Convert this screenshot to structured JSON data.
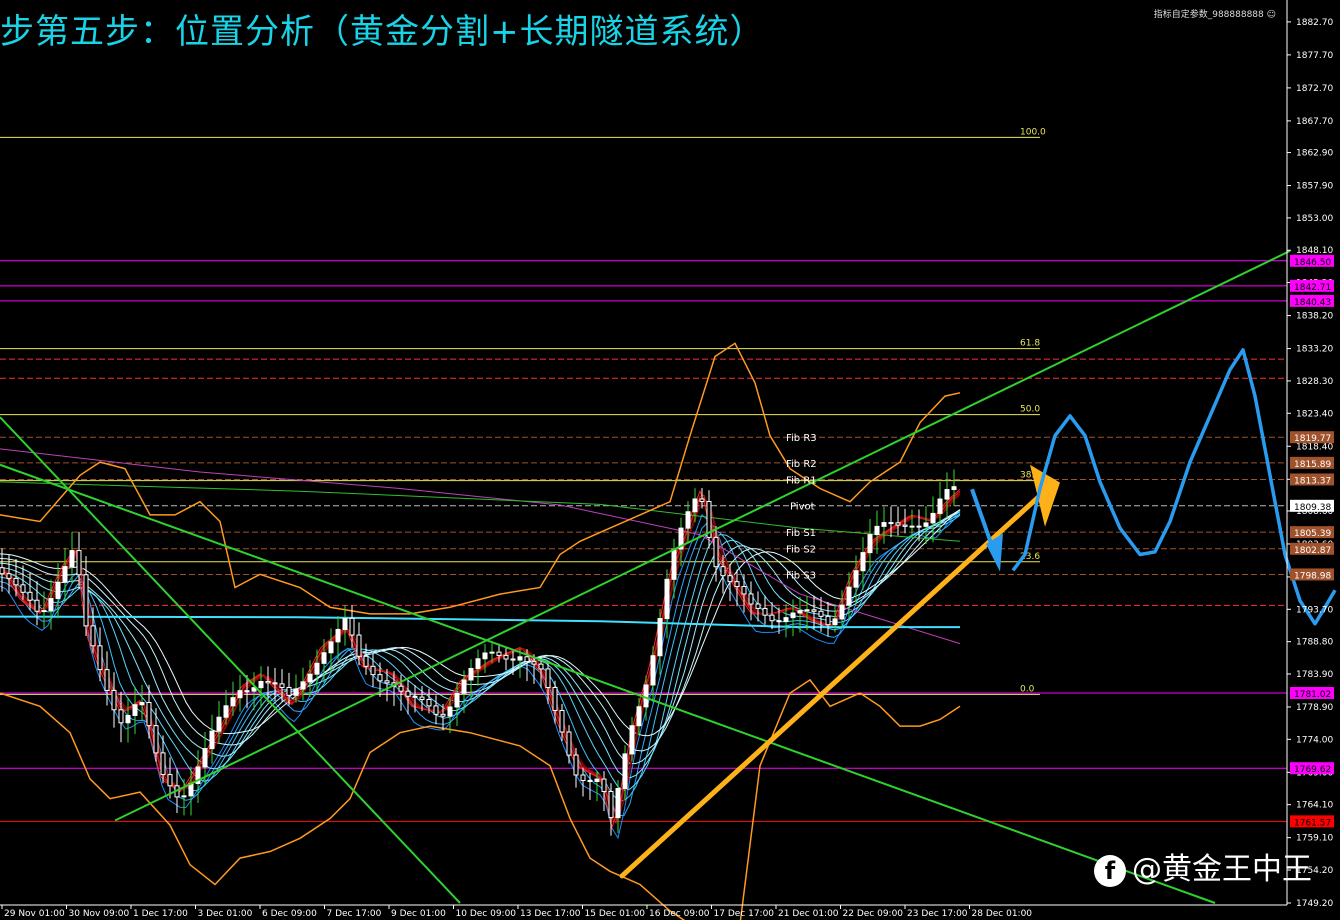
{
  "title": "步第五步：位置分析（黄金分割+长期隧道系统）",
  "ea_label": "指标自定参数_988888888 ☺",
  "watermark": "@黄金王中王",
  "watermark_badge": "f",
  "chart_data": {
    "type": "line",
    "yaxis": {
      "min": 1749.2,
      "max": 1884.5,
      "side": "right"
    },
    "y_ticks": [
      "1882.70",
      "1877.70",
      "1872.70",
      "1867.70",
      "1862.90",
      "1857.90",
      "1853.00",
      "1848.10",
      "1843.20",
      "1838.20",
      "1833.20",
      "1828.30",
      "1823.40",
      "1818.40",
      "1813.40",
      "1808.60",
      "1803.60",
      "1798.60",
      "1793.70",
      "1788.80",
      "1783.90",
      "1778.90",
      "1774.00",
      "1769.00",
      "1764.10",
      "1759.10",
      "1754.20",
      "1749.20"
    ],
    "x_ticks": [
      {
        "label": "29 Nov 01:00",
        "x": 0
      },
      {
        "label": "30 Nov 09:00",
        "x": 1
      },
      {
        "label": "1 Dec 17:00",
        "x": 2
      },
      {
        "label": "3 Dec 01:00",
        "x": 3
      },
      {
        "label": "6 Dec 09:00",
        "x": 4
      },
      {
        "label": "7 Dec 17:00",
        "x": 5
      },
      {
        "label": "9 Dec 01:00",
        "x": 6
      },
      {
        "label": "10 Dec 09:00",
        "x": 7
      },
      {
        "label": "13 Dec 17:00",
        "x": 8
      },
      {
        "label": "15 Dec 01:00",
        "x": 9
      },
      {
        "label": "16 Dec 09:00",
        "x": 10
      },
      {
        "label": "17 Dec 17:00",
        "x": 11
      },
      {
        "label": "21 Dec 01:00",
        "x": 12
      },
      {
        "label": "22 Dec 09:00",
        "x": 13
      },
      {
        "label": "23 Dec 17:00",
        "x": 14
      },
      {
        "label": "28 Dec 01:00",
        "x": 15
      }
    ],
    "fib_levels": [
      {
        "label": "100.0",
        "price": 1865.2
      },
      {
        "label": "61.8",
        "price": 1833.2
      },
      {
        "label": "50.0",
        "price": 1823.2
      },
      {
        "label": "38.2",
        "price": 1813.2
      },
      {
        "label": "23.6",
        "price": 1800.9
      },
      {
        "label": "0.0",
        "price": 1780.8
      }
    ],
    "pivot_labels": [
      {
        "label": "Fib R3",
        "price": 1819.8
      },
      {
        "label": "Fib R2",
        "price": 1815.9
      },
      {
        "label": "Fib R1",
        "price": 1813.4
      },
      {
        "label": "Pivot",
        "price": 1809.4
      },
      {
        "label": "Fib S1",
        "price": 1805.4
      },
      {
        "label": "Fib S2",
        "price": 1802.9
      },
      {
        "label": "Fib S3",
        "price": 1799.0
      }
    ],
    "price_tags": [
      {
        "value": "1846.50",
        "price": 1846.5,
        "color": "#ff00ff",
        "text": "#000000"
      },
      {
        "value": "1842.71",
        "price": 1842.71,
        "color": "#ff00ff",
        "text": "#000000"
      },
      {
        "value": "1840.43",
        "price": 1840.43,
        "color": "#ff00ff",
        "text": "#000000"
      },
      {
        "value": "1819.77",
        "price": 1819.77,
        "color": "#a0522d",
        "text": "#ffffff"
      },
      {
        "value": "1815.89",
        "price": 1815.89,
        "color": "#a0522d",
        "text": "#ffffff"
      },
      {
        "value": "1813.37",
        "price": 1813.37,
        "color": "#a0522d",
        "text": "#ffffff"
      },
      {
        "value": "1809.38",
        "price": 1809.38,
        "color": "#ffffff",
        "text": "#000000"
      },
      {
        "value": "1805.39",
        "price": 1805.39,
        "color": "#a0522d",
        "text": "#ffffff"
      },
      {
        "value": "1802.87",
        "price": 1802.87,
        "color": "#a0522d",
        "text": "#ffffff"
      },
      {
        "value": "1798.98",
        "price": 1798.98,
        "color": "#a0522d",
        "text": "#ffffff"
      },
      {
        "value": "1781.02",
        "price": 1781.02,
        "color": "#ff00ff",
        "text": "#000000"
      },
      {
        "value": "1769.62",
        "price": 1769.62,
        "color": "#ff00ff",
        "text": "#000000"
      },
      {
        "value": "1761.57",
        "price": 1761.57,
        "color": "#ff0000",
        "text": "#000000"
      }
    ],
    "magenta_levels": [
      1846.5,
      1842.71,
      1840.43,
      1781.02,
      1769.62
    ],
    "red_level": 1761.57,
    "dash_levels": [
      {
        "price": 1831.6,
        "color": "#ff3030"
      },
      {
        "price": 1828.7,
        "color": "#ff3030"
      },
      {
        "price": 1819.77,
        "color": "#a0522d"
      },
      {
        "price": 1815.89,
        "color": "#a0522d"
      },
      {
        "price": 1813.37,
        "color": "#a0522d"
      },
      {
        "price": 1809.38,
        "color": "#bbbbbb"
      },
      {
        "price": 1805.39,
        "color": "#a0522d"
      },
      {
        "price": 1802.87,
        "color": "#a0522d"
      },
      {
        "price": 1798.98,
        "color": "#a0522d"
      },
      {
        "price": 1794.3,
        "color": "#ff3030"
      }
    ],
    "colors": {
      "axis": "#ffffff",
      "fib": "#e8e85a",
      "magenta": "#ff00ff",
      "tunnel_cyan": "#40e0ff",
      "trend_green": "#2fd12f",
      "bollinger": "#ff9a1f",
      "forecast_blue": "#2a9cf0",
      "arrow_orange": "#ffb11a",
      "ema_red": "#ff2020",
      "candle": "#ffffff",
      "candle_bull_shadow": "#33dd33"
    }
  }
}
